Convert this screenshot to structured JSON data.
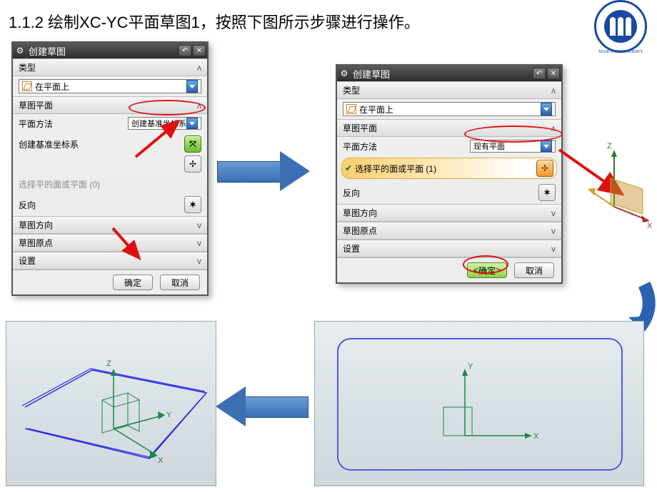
{
  "title": "1.1.2 绘制XC-YC平面草图1，按照下图所示步骤进行操作。",
  "logo": {
    "top": "XIANGTAN",
    "bot": "UNIVERSITY"
  },
  "dialog1": {
    "title": "创建草图",
    "sect_type": "类型",
    "combo_type": "在平面上",
    "sect_plane": "草图平面",
    "row_method": "平面方法",
    "method_val": "创建基准坐标系",
    "row_cs": "创建基准坐标系",
    "row_selface": "选择平的面或平面 (0)",
    "row_reverse": "反向",
    "sect_orient": "草图方向",
    "sect_origin": "草图原点",
    "sect_settings": "设置",
    "ok": "确定",
    "cancel": "取消"
  },
  "dialog2": {
    "title": "创建草图",
    "sect_type": "类型",
    "combo_type": "在平面上",
    "sect_plane": "草图平面",
    "row_method": "平面方法",
    "method_val": "现有平面",
    "row_selface": "选择平的面或平面 (1)",
    "row_reverse": "反向",
    "sect_orient": "草图方向",
    "sect_origin": "草图原点",
    "sect_settings": "设置",
    "ok": "确定",
    "cancel": "取消"
  },
  "axis": {
    "x": "X",
    "y": "Y",
    "z": "Z"
  }
}
